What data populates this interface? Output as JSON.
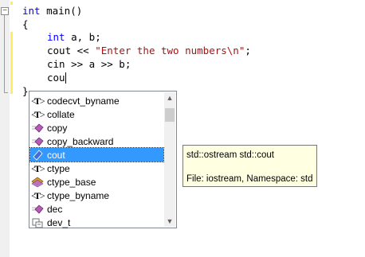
{
  "editor": {
    "lines": [
      {
        "kw": "int",
        "text": " main()"
      },
      {
        "text": "{"
      },
      {
        "kw": "int",
        "text": " a, b;"
      },
      {
        "pre": "cout << ",
        "str": "\"Enter the two numbers\\n\"",
        "post": ";"
      },
      {
        "text": "cin >> a >> b;"
      },
      {
        "text": "cou"
      },
      {
        "text": "}"
      }
    ]
  },
  "completion": {
    "items": [
      {
        "label": "codecvt_byname",
        "icon": "template-type-icon"
      },
      {
        "label": "collate",
        "icon": "template-type-icon"
      },
      {
        "label": "copy",
        "icon": "function-icon"
      },
      {
        "label": "copy_backward",
        "icon": "function-icon"
      },
      {
        "label": "cout",
        "icon": "variable-icon",
        "selected": true
      },
      {
        "label": "ctype",
        "icon": "template-type-icon"
      },
      {
        "label": "ctype_base",
        "icon": "class-icon"
      },
      {
        "label": "ctype_byname",
        "icon": "template-type-icon"
      },
      {
        "label": "dec",
        "icon": "function-icon"
      },
      {
        "label": "dev_t",
        "icon": "typedef-icon"
      }
    ]
  },
  "tooltip": {
    "declaration": "std::ostream std::cout",
    "location": "File: iostream, Namespace: std"
  },
  "colors": {
    "keyword": "#0000ff",
    "string": "#a31515",
    "selection": "#3399ff",
    "tooltip_bg": "#ffffe1",
    "change_bar": "#ffee62"
  }
}
